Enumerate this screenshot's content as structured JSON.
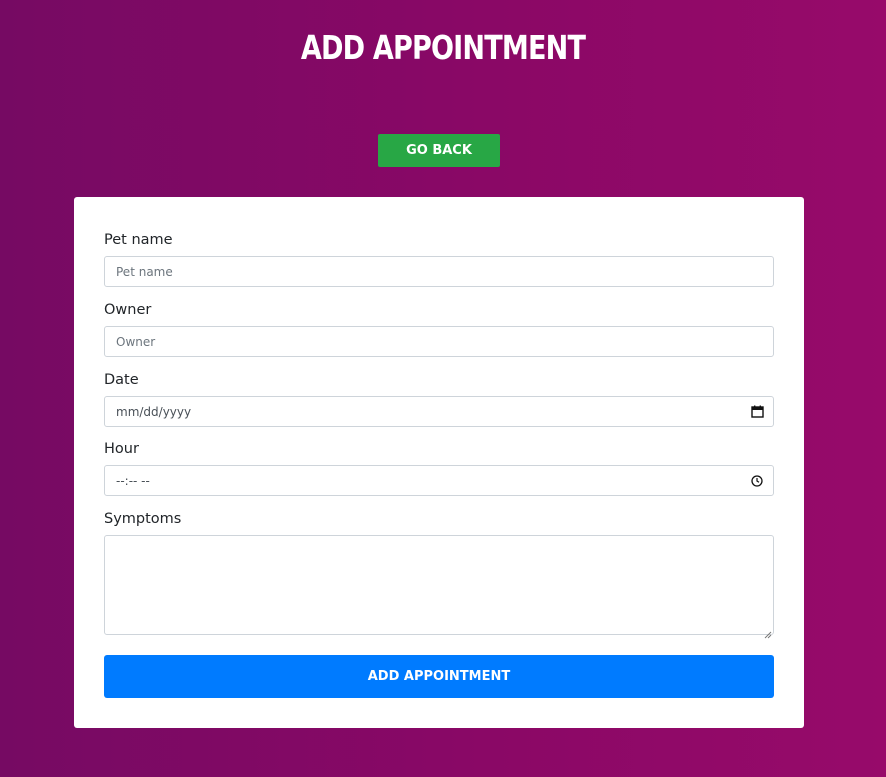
{
  "header": {
    "title": "ADD APPOINTMENT"
  },
  "actions": {
    "go_back_label": "GO BACK"
  },
  "form": {
    "pet_name": {
      "label": "Pet name",
      "placeholder": "Pet name",
      "value": ""
    },
    "owner": {
      "label": "Owner",
      "placeholder": "Owner",
      "value": ""
    },
    "date": {
      "label": "Date",
      "display": "mm/dd/yyyy",
      "icon": "calendar-icon"
    },
    "hour": {
      "label": "Hour",
      "display": "--:-- --",
      "icon": "clock-icon"
    },
    "symptoms": {
      "label": "Symptoms",
      "value": ""
    },
    "submit_label": "ADD APPOINTMENT"
  },
  "colors": {
    "background_gradient": [
      "#760a63",
      "#970a6a"
    ],
    "go_back_button": "#28a745",
    "submit_button": "#007bff",
    "card": "#ffffff"
  }
}
